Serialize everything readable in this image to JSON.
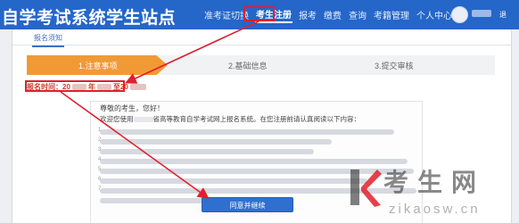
{
  "header": {
    "title": "自学考试系统学生站点",
    "nav": [
      "准考证切换",
      "考生注册",
      "报考",
      "缴费",
      "查询",
      "考籍管理",
      "个人中心"
    ],
    "active_nav": "考生注册",
    "user_tag": "退",
    "color": "#2566c9"
  },
  "panel": {
    "tab": "报名须知",
    "steps": [
      "1.注意事项",
      "2.基础信息",
      "3.提交审核"
    ],
    "active_step_color": "#f19a35",
    "report_time": {
      "label": "报名时间：20",
      "mid": "年",
      "sep": "至20"
    },
    "notice": {
      "greeting": "尊敬的考生，您好！",
      "intro_before": "欢迎您使用",
      "intro_after": "省高等教育自学考试网上报名系统。在您注册前请认真阅读以下内容："
    },
    "agree_button": "同意并继续"
  },
  "watermark": {
    "title": "考生网",
    "url": "zikaosw.cn",
    "accent": "#e0202e"
  }
}
